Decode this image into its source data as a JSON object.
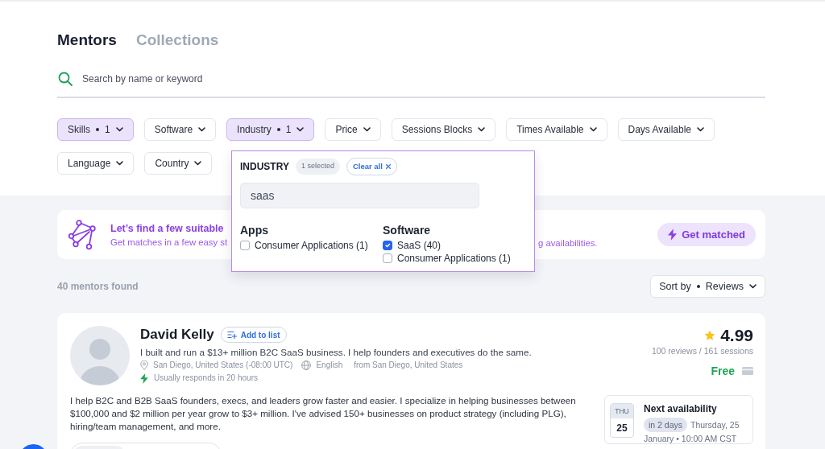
{
  "tabs": [
    {
      "label": "Mentors",
      "selected": true
    },
    {
      "label": "Collections",
      "selected": false
    }
  ],
  "search": {
    "placeholder": "Search by name or keyword"
  },
  "filters": [
    {
      "label": "Skills",
      "count": "1",
      "active": true
    },
    {
      "label": "Software",
      "active": false
    },
    {
      "label": "Industry",
      "count": "1",
      "active": true
    },
    {
      "label": "Price",
      "active": false
    },
    {
      "label": "Sessions Blocks",
      "active": false
    },
    {
      "label": "Times Available",
      "active": false
    },
    {
      "label": "Days Available",
      "active": false
    },
    {
      "label": "Language",
      "active": false
    },
    {
      "label": "Country",
      "active": false
    }
  ],
  "industry_dropdown": {
    "title": "INDUSTRY",
    "selected_count": "1 selected",
    "clear_label": "Clear all",
    "query": "saas",
    "groups": [
      {
        "heading": "Apps",
        "options": [
          {
            "label": "Consumer Applications (1)",
            "checked": false
          }
        ]
      },
      {
        "heading": "Software",
        "options": [
          {
            "label": "SaaS (40)",
            "checked": true
          },
          {
            "label": "Consumer Applications (1)",
            "checked": false
          }
        ]
      }
    ]
  },
  "match_banner": {
    "title": "Let’s find a few suitable",
    "subtitle_start": "Get matches in a few easy st",
    "subtitle_end": "g availabilities.",
    "button": "Get matched"
  },
  "results": {
    "count": "40 mentors found",
    "sort_label": "Sort by",
    "sort_value": "Reviews"
  },
  "mentor": {
    "name": "David Kelly",
    "add_to_list": "Add to list",
    "tagline": "I built and run a $13+ million B2C SaaS business. I help founders and executives do the same.",
    "location": "San Diego, United States (-08:00 UTC)",
    "language": "English",
    "origin": "from San Diego, United States",
    "response": "Usually responds in 20 hours",
    "rating": "4.99",
    "reviews": "100 reviews / 161 sessions",
    "price": "Free",
    "bio": "I help B2C and B2B SaaS founders, execs, and leaders grow faster and easier. I specialize in helping businesses between $100,000 and $2 million per year grow to $3+ million. I've advised 150+ businesses on product strategy (including PLG), hiring/team management, and more.",
    "availability": {
      "title": "Next availability",
      "weekday": "THU",
      "day": "25",
      "relative": "in 2 days",
      "date_line": "Thursday, 25",
      "time_line": "January • 10:00 AM CST"
    }
  }
}
